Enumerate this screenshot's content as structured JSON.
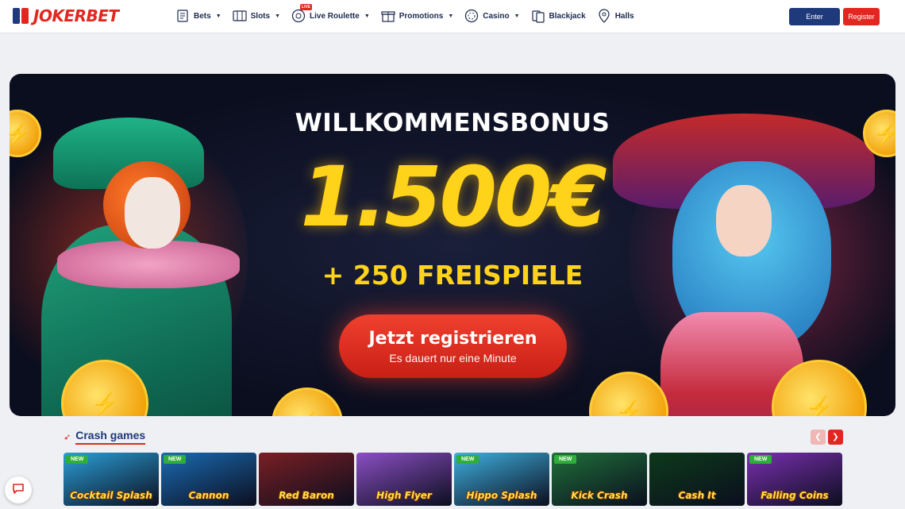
{
  "brand": {
    "name": "JOKERBET",
    "color": "#e3261f"
  },
  "nav": [
    {
      "label": "Bets",
      "icon": "bets-icon",
      "dropdown": true
    },
    {
      "label": "Slots",
      "icon": "slots-icon",
      "dropdown": true
    },
    {
      "label": "Live Roulette",
      "icon": "roulette-icon",
      "dropdown": true,
      "badge": "LIVE"
    },
    {
      "label": "Promotions",
      "icon": "gift-icon",
      "dropdown": true
    },
    {
      "label": "Casino",
      "icon": "casino-chip-icon",
      "dropdown": true
    },
    {
      "label": "Blackjack",
      "icon": "blackjack-icon",
      "dropdown": false
    },
    {
      "label": "Halls",
      "icon": "location-pin-icon",
      "dropdown": false
    }
  ],
  "auth": {
    "enter_label": "Enter",
    "register_label": "Register"
  },
  "hero": {
    "title": "WILLKOMMENSBONUS",
    "amount": "1.500€",
    "subtitle": "+ 250 FREISPIELE",
    "cta_main": "Jetzt registrieren",
    "cta_sub": "Es dauert nur eine Minute"
  },
  "crash_games": {
    "title": "Crash games",
    "tiles": [
      {
        "name": "Cocktail Splash",
        "new": "NEW",
        "bg": "#2b9fd8"
      },
      {
        "name": "Cannon",
        "new": "NEW",
        "bg": "#1a6bb3"
      },
      {
        "name": "Red Baron",
        "new": "",
        "bg": "#7a1f24"
      },
      {
        "name": "High Flyer",
        "new": "",
        "bg": "#8b4fc4"
      },
      {
        "name": "Hippo Splash",
        "new": "NEW",
        "bg": "#3fb0e0"
      },
      {
        "name": "Kick Crash",
        "new": "NEW",
        "bg": "#1f6f3a"
      },
      {
        "name": "Cash It",
        "new": "",
        "bg": "#0c3a1a"
      },
      {
        "name": "Falling Coins",
        "new": "NEW",
        "bg": "#7a2fb0"
      }
    ]
  }
}
